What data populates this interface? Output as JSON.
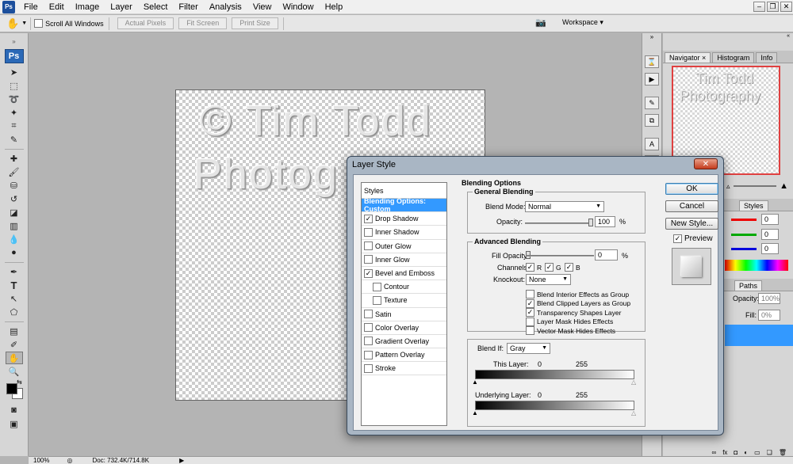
{
  "app": {
    "logo": "Ps"
  },
  "menu": [
    "File",
    "Edit",
    "Image",
    "Layer",
    "Select",
    "Filter",
    "Analysis",
    "View",
    "Window",
    "Help"
  ],
  "window_controls": {
    "minimize": "–",
    "restore": "❐",
    "close": "✕"
  },
  "options_bar": {
    "scroll_all_windows": "Scroll All Windows",
    "actual_pixels": "Actual Pixels",
    "fit_screen": "Fit Screen",
    "print_size": "Print Size",
    "workspace": "Workspace ▾"
  },
  "canvas": {
    "watermark_line1": "© Tim Todd",
    "watermark_line2": "Photog"
  },
  "panels": {
    "navigator_tabs": [
      "Navigator",
      "Histogram",
      "Info"
    ],
    "navigator_close": "×",
    "navigator_text1": "Tim Todd",
    "navigator_text2": "Photography",
    "color_tab": "Styles",
    "color_values": [
      "0",
      "0",
      "0"
    ],
    "layers_tab": "Paths",
    "opacity_label": "Opacity:",
    "opacity_value": "100%",
    "fill_label": "Fill:",
    "fill_value": "0%"
  },
  "status": {
    "zoom": "100%",
    "doc": "Doc: 732.4K/714.8K"
  },
  "dialog": {
    "title": "Layer Style",
    "close": "✕",
    "styles_header": "Styles",
    "styles": [
      {
        "label": "Blending Options: Custom",
        "selected": true,
        "checkbox": false,
        "checked": false,
        "indent": false
      },
      {
        "label": "Drop Shadow",
        "checkbox": true,
        "checked": true,
        "indent": false
      },
      {
        "label": "Inner Shadow",
        "checkbox": true,
        "checked": false,
        "indent": false
      },
      {
        "label": "Outer Glow",
        "checkbox": true,
        "checked": false,
        "indent": false
      },
      {
        "label": "Inner Glow",
        "checkbox": true,
        "checked": false,
        "indent": false
      },
      {
        "label": "Bevel and Emboss",
        "checkbox": true,
        "checked": true,
        "indent": false
      },
      {
        "label": "Contour",
        "checkbox": true,
        "checked": false,
        "indent": true
      },
      {
        "label": "Texture",
        "checkbox": true,
        "checked": false,
        "indent": true
      },
      {
        "label": "Satin",
        "checkbox": true,
        "checked": false,
        "indent": false
      },
      {
        "label": "Color Overlay",
        "checkbox": true,
        "checked": false,
        "indent": false
      },
      {
        "label": "Gradient Overlay",
        "checkbox": true,
        "checked": false,
        "indent": false
      },
      {
        "label": "Pattern Overlay",
        "checkbox": true,
        "checked": false,
        "indent": false
      },
      {
        "label": "Stroke",
        "checkbox": true,
        "checked": false,
        "indent": false
      }
    ],
    "blending_options": "Blending Options",
    "general_blending": "General Blending",
    "blend_mode_label": "Blend Mode:",
    "blend_mode_value": "Normal",
    "opacity_label": "Opacity:",
    "opacity_value": "100",
    "percent": "%",
    "advanced_blending": "Advanced Blending",
    "fill_opacity_label": "Fill Opacity:",
    "fill_opacity_value": "0",
    "channels_label": "Channels:",
    "channels": [
      "R",
      "G",
      "B"
    ],
    "knockout_label": "Knockout:",
    "knockout_value": "None",
    "adv_checks": [
      {
        "label": "Blend Interior Effects as Group",
        "checked": false
      },
      {
        "label": "Blend Clipped Layers as Group",
        "checked": true
      },
      {
        "label": "Transparency Shapes Layer",
        "checked": true
      },
      {
        "label": "Layer Mask Hides Effects",
        "checked": false
      },
      {
        "label": "Vector Mask Hides Effects",
        "checked": false
      }
    ],
    "blend_if_label": "Blend If:",
    "blend_if_value": "Gray",
    "this_layer_label": "This Layer:",
    "this_layer_min": "0",
    "this_layer_max": "255",
    "underlying_label": "Underlying Layer:",
    "underlying_min": "0",
    "underlying_max": "255",
    "buttons": {
      "ok": "OK",
      "cancel": "Cancel",
      "new_style": "New Style..."
    },
    "preview_label": "Preview"
  }
}
